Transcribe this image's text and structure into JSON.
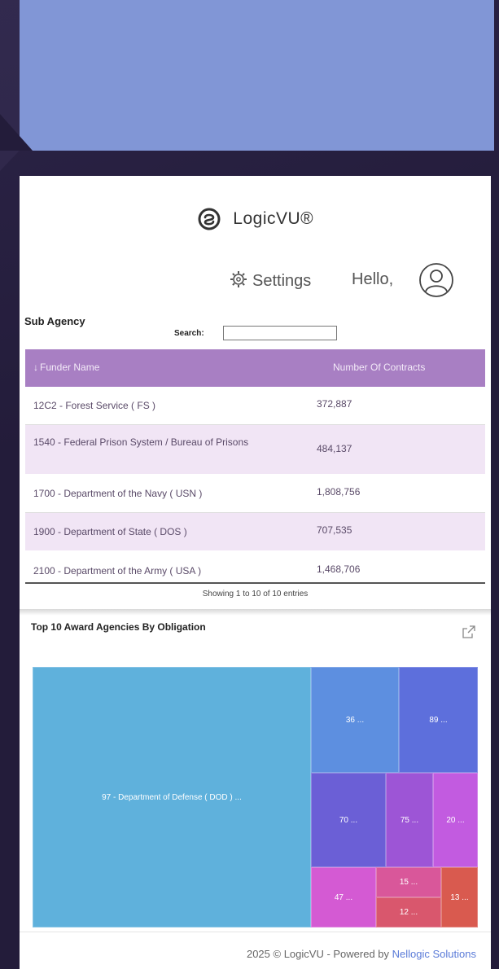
{
  "brand": {
    "name": "LogicVU®"
  },
  "header": {
    "settings_label": "Settings",
    "hello_label": "Hello,"
  },
  "sub_agency": {
    "title": "Sub Agency",
    "search_label": "Search:",
    "search_value": "",
    "columns": [
      "Funder Name",
      "Number Of Contracts"
    ],
    "rows": [
      {
        "name": "12C2 - Forest Service ( FS )",
        "contracts": "372,887"
      },
      {
        "name": "1540 - Federal Prison System / Bureau of Prisons",
        "contracts": "484,137"
      },
      {
        "name": "1700 - Department of the Navy ( USN )",
        "contracts": "1,808,756"
      },
      {
        "name": "1900 - Department of State ( DOS )",
        "contracts": "707,535"
      },
      {
        "name": "2100 - Department of the Army ( USA )",
        "contracts": "1,468,706"
      }
    ],
    "showing": "Showing 1 to 10 of 10 entries"
  },
  "chart": {
    "title": "Top 10 Award Agencies By Obligation",
    "tiles": [
      {
        "label": "97 - Department of Defense ( DOD ) ...",
        "color": "#5fb1dc"
      },
      {
        "label": "36 ...",
        "color": "#5d8fe0"
      },
      {
        "label": "89 ...",
        "color": "#5d6fdc"
      },
      {
        "label": "70 ...",
        "color": "#6b5fd6"
      },
      {
        "label": "75 ...",
        "color": "#9d55d6"
      },
      {
        "label": "20 ...",
        "color": "#c25be0"
      },
      {
        "label": "47 ...",
        "color": "#d45ad3"
      },
      {
        "label": "15 ...",
        "color": "#d9579a"
      },
      {
        "label": "12 ...",
        "color": "#d9576d"
      },
      {
        "label": "13 ...",
        "color": "#d95a4f"
      }
    ]
  },
  "footer": {
    "text": "2025 © LogicVU - Powered by ",
    "link": "Nellogic Solutions"
  },
  "colors": {
    "header_bg": "#a87fc3",
    "row_alt": "#f1e5f5",
    "banner": "#8196d6",
    "page_bg": "#231c3a"
  }
}
